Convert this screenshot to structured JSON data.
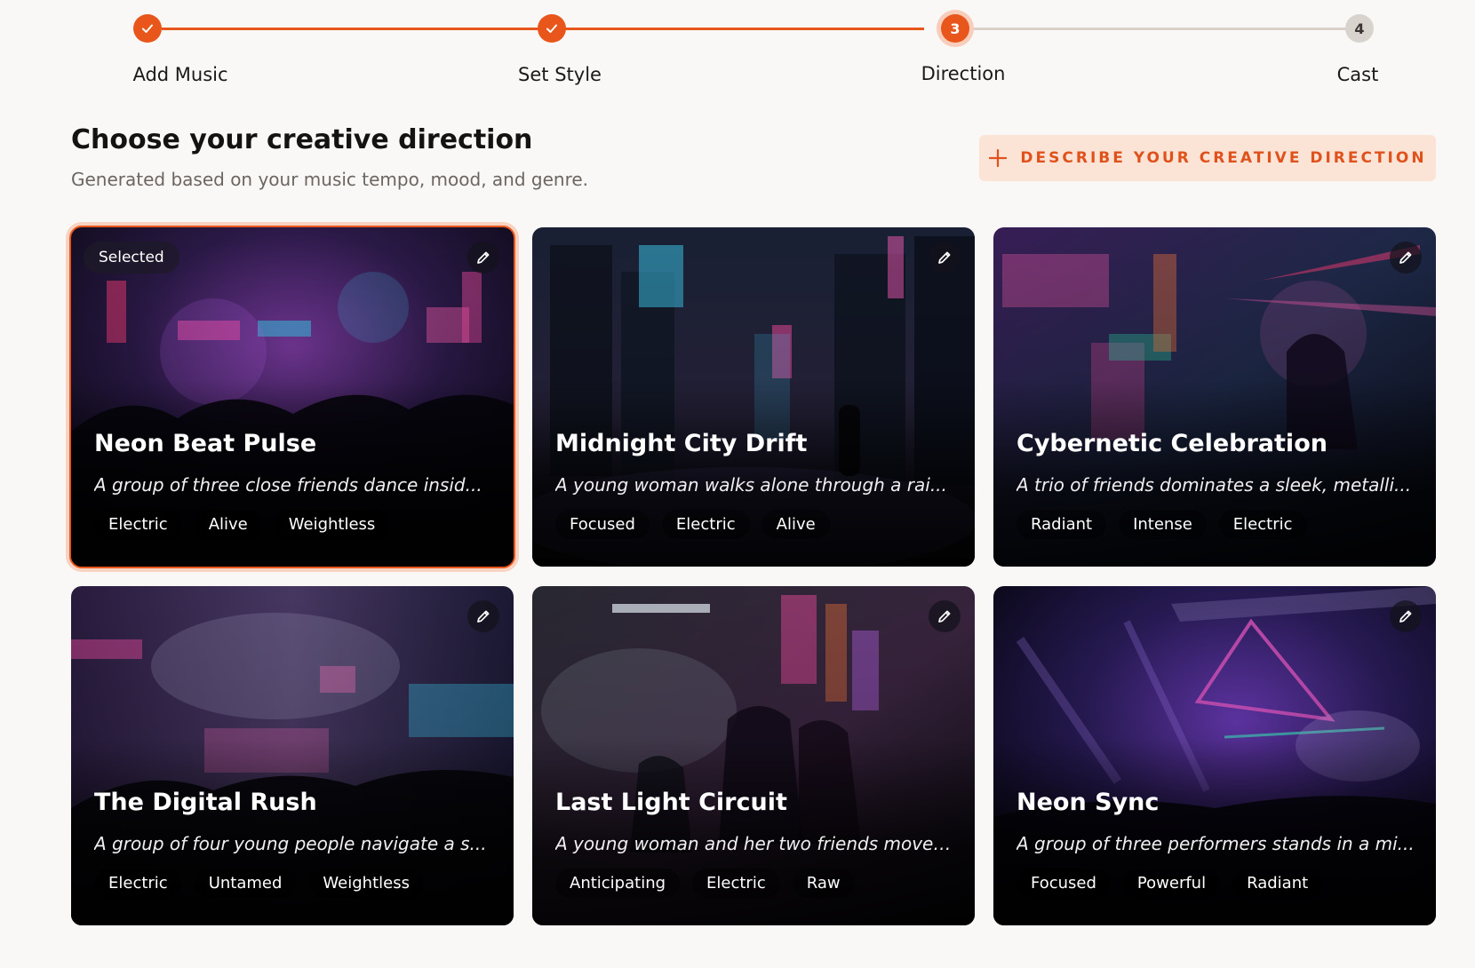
{
  "stepper": {
    "steps": [
      {
        "label": "Add Music",
        "state": "done",
        "number": ""
      },
      {
        "label": "Set Style",
        "state": "done",
        "number": ""
      },
      {
        "label": "Direction",
        "state": "current",
        "number": "3"
      },
      {
        "label": "Cast",
        "state": "todo",
        "number": "4"
      }
    ]
  },
  "header": {
    "title": "Choose your creative direction",
    "subtitle": "Generated based on your music tempo, mood, and genre.",
    "describe_button": "DESCRIBE YOUR CREATIVE DIRECTION"
  },
  "cards": [
    {
      "title": "Neon Beat Pulse",
      "description": "A group of three close friends dance insid...",
      "tags": [
        "Electric",
        "Alive",
        "Weightless"
      ],
      "selected": true,
      "badge": "Selected"
    },
    {
      "title": "Midnight City Drift",
      "description": "A young woman walks alone through a rai...",
      "tags": [
        "Focused",
        "Electric",
        "Alive"
      ],
      "selected": false
    },
    {
      "title": "Cybernetic Celebration",
      "description": "A trio of friends dominates a sleek, metalli...",
      "tags": [
        "Radiant",
        "Intense",
        "Electric"
      ],
      "selected": false
    },
    {
      "title": "The Digital Rush",
      "description": "A group of four young people navigate a s...",
      "tags": [
        "Electric",
        "Untamed",
        "Weightless"
      ],
      "selected": false
    },
    {
      "title": "Last Light Circuit",
      "description": "A young woman and her two friends move ...",
      "tags": [
        "Anticipating",
        "Electric",
        "Raw"
      ],
      "selected": false
    },
    {
      "title": "Neon Sync",
      "description": "A group of three performers stands in a mi...",
      "tags": [
        "Focused",
        "Powerful",
        "Radiant"
      ],
      "selected": false
    }
  ],
  "colors": {
    "accent": "#e8561c",
    "accent_soft": "#fbe3d6",
    "background": "#faf8f6"
  }
}
